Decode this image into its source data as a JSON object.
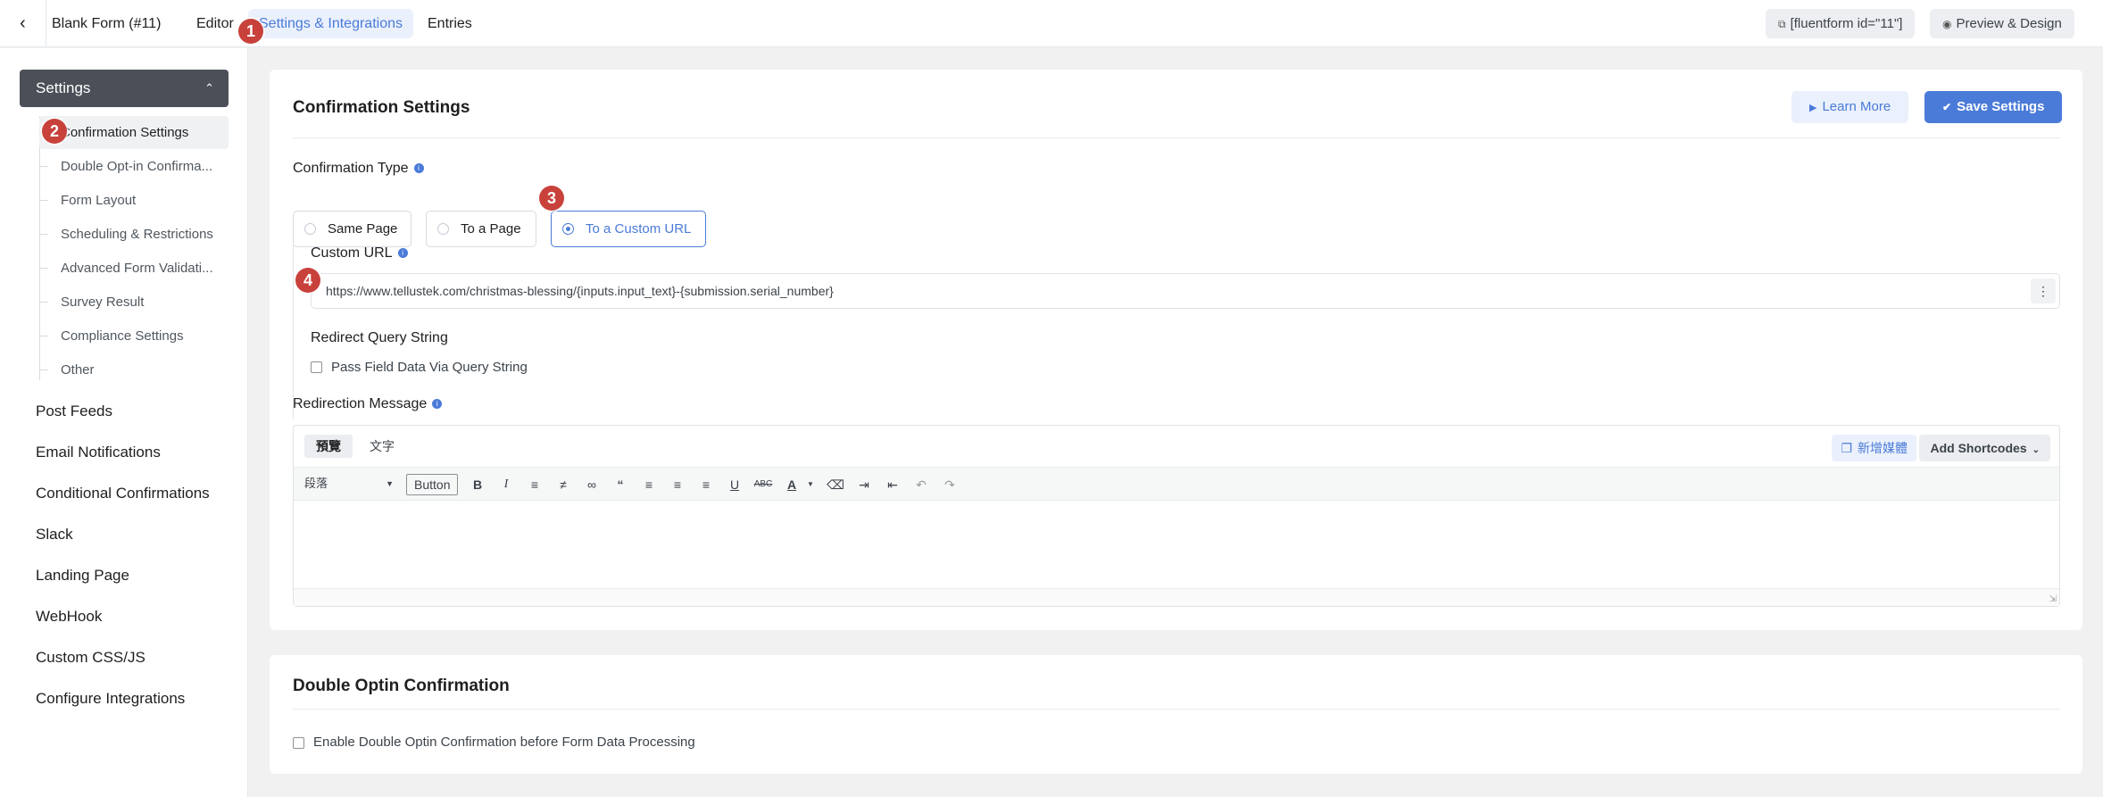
{
  "header": {
    "back_icon": "chevron-left-icon",
    "form_name": "Blank Form (#11)",
    "tabs": [
      {
        "label": "Editor"
      },
      {
        "label": "Settings & Integrations"
      },
      {
        "label": "Entries"
      }
    ],
    "shortcode": "[fluentform id=\"11\"]",
    "preview": "Preview & Design"
  },
  "sidebar": {
    "section_title": "Settings",
    "sub_items": [
      {
        "label": "Confirmation Settings"
      },
      {
        "label": "Double Opt-in Confirma..."
      },
      {
        "label": "Form Layout"
      },
      {
        "label": "Scheduling & Restrictions"
      },
      {
        "label": "Advanced Form Validati..."
      },
      {
        "label": "Survey Result"
      },
      {
        "label": "Compliance Settings"
      },
      {
        "label": "Other"
      }
    ],
    "main_items": [
      {
        "label": "Post Feeds"
      },
      {
        "label": "Email Notifications"
      },
      {
        "label": "Conditional Confirmations"
      },
      {
        "label": "Slack"
      },
      {
        "label": "Landing Page"
      },
      {
        "label": "WebHook"
      },
      {
        "label": "Custom CSS/JS"
      },
      {
        "label": "Configure Integrations"
      }
    ]
  },
  "confirmation": {
    "title": "Confirmation Settings",
    "learn_more": "Learn More",
    "save": "Save Settings",
    "type_label": "Confirmation Type",
    "options": [
      {
        "label": "Same Page"
      },
      {
        "label": "To a Page"
      },
      {
        "label": "To a Custom URL"
      }
    ],
    "selected_option": "To a Custom URL",
    "custom_url_label": "Custom URL",
    "custom_url_value": "https://www.tellustek.com/christmas-blessing/{inputs.input_text}-{submission.serial_number}",
    "redirect_query_label": "Redirect Query String",
    "pass_field_label": "Pass Field Data Via Query String",
    "redirection_message_label": "Redirection Message",
    "editor": {
      "tab_visual": "預覽",
      "tab_text": "文字",
      "add_media": "新增媒體",
      "add_shortcodes": "Add Shortcodes",
      "format_select": "段落",
      "button_label": "Button",
      "toolbar_icons": [
        "bold-icon",
        "italic-icon",
        "bullet-list-icon",
        "numbered-list-icon",
        "link-icon",
        "blockquote-icon",
        "align-left-icon",
        "align-center-icon",
        "align-right-icon",
        "underline-icon",
        "strikethrough-icon",
        "text-color-icon",
        "clear-format-icon",
        "indent-icon",
        "outdent-icon",
        "undo-icon",
        "redo-icon"
      ]
    }
  },
  "double_optin": {
    "title": "Double Optin Confirmation",
    "enable_label": "Enable Double Optin Confirmation before Form Data Processing"
  },
  "markers": [
    "1",
    "2",
    "3",
    "4"
  ],
  "colors": {
    "accent": "#4b7bd8",
    "sidebar_head": "#4b5058",
    "marker": "#c8413b"
  }
}
